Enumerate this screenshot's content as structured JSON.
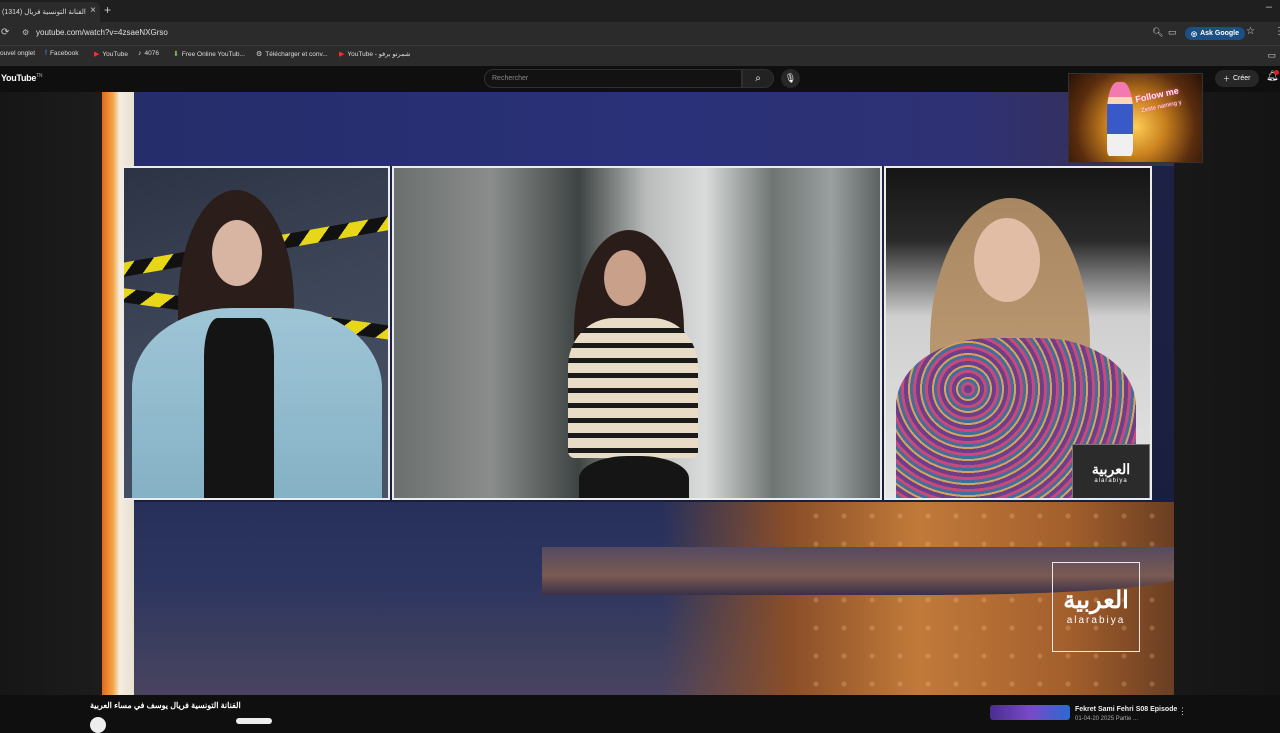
{
  "browser": {
    "tab_title": "(1314) الفنانة التونسية فريال",
    "tab_close": "×",
    "new_tab": "+",
    "minimize": "–",
    "url": "youtube.com/watch?v=4zsaeNXGrso",
    "ask_google": "Ask Google",
    "bookmarks": [
      {
        "label": "ouvel onglet",
        "icon": ""
      },
      {
        "label": "Facebook",
        "icon": "f"
      },
      {
        "label": "YouTube",
        "icon": "▶"
      },
      {
        "label": "4076",
        "icon": "♪"
      },
      {
        "label": "Free Online YouTub...",
        "icon": "⬇"
      },
      {
        "label": "Télécharger et conv...",
        "icon": "⚙"
      },
      {
        "label": "YouTube - شمرتو برفو",
        "icon": "▶"
      }
    ]
  },
  "youtube": {
    "logo": "YouTube",
    "logo_tm": "TN",
    "search_placeholder": "Rechercher",
    "create_label": "Créer",
    "video": {
      "channel_logo_ar": "العربية",
      "channel_logo_en": "alarabiya",
      "mini_logo_ar": "العربية",
      "mini_logo_en": "alarabiya"
    },
    "ad": {
      "headline": "Follow me",
      "subline": "Zeste naming y"
    },
    "below": {
      "video_title": "الفنانة التونسية فريال يوسف في مساء العربية"
    },
    "recommended": {
      "title": "Fekret Sami Fehri S08 Episode",
      "meta": "01-04-20 2025 Partie ..."
    }
  },
  "colors": {
    "accent": "#1b4f86",
    "notification": "#e02020",
    "edge_orange": "#e06a1a"
  }
}
